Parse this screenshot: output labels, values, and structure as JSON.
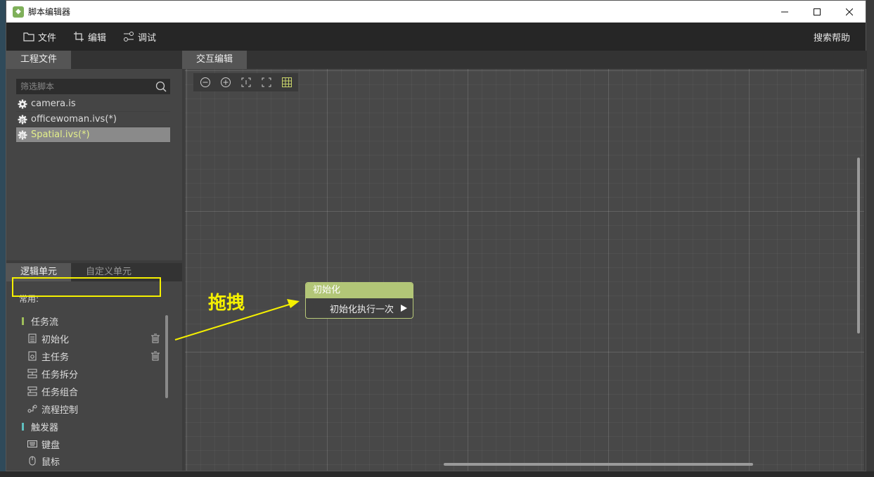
{
  "window": {
    "title": "脚本编辑器",
    "controls": [
      "minimize",
      "maximize",
      "close"
    ]
  },
  "menubar": {
    "items": [
      {
        "label": "文件",
        "icon": "folder-icon"
      },
      {
        "label": "编辑",
        "icon": "crop-icon"
      },
      {
        "label": "调试",
        "icon": "debug-icon"
      }
    ],
    "help_label": "搜索帮助"
  },
  "project_panel": {
    "tab_label": "工程文件",
    "search": {
      "placeholder": "筛选脚本"
    },
    "files": [
      {
        "name": "camera.is",
        "icon": "gear-icon",
        "selected": false
      },
      {
        "name": "officewoman.ivs(*)",
        "icon": "gear-js-icon",
        "selected": false
      },
      {
        "name": "Spatial.ivs(*)",
        "icon": "gear-js-icon",
        "selected": true
      }
    ]
  },
  "logic_panel": {
    "tabs": [
      {
        "label": "逻辑单元",
        "active": true
      },
      {
        "label": "自定义单元",
        "active": false
      }
    ],
    "section_label": "常用:",
    "categories": [
      {
        "label": "任务流",
        "color": "#9fbf5a",
        "units": [
          {
            "label": "初始化",
            "icon": "clipboard-icon",
            "has_trash": true
          },
          {
            "label": "主任务",
            "icon": "task-icon",
            "has_trash": true
          },
          {
            "label": "任务拆分",
            "icon": "split-icon",
            "has_trash": false
          },
          {
            "label": "任务组合",
            "icon": "combine-icon",
            "has_trash": false
          },
          {
            "label": "流程控制",
            "icon": "flow-icon",
            "has_trash": false
          }
        ]
      },
      {
        "label": "触发器",
        "color": "#5fbfbf",
        "units": [
          {
            "label": "键盘",
            "icon": "keyboard-icon",
            "has_trash": false
          },
          {
            "label": "鼠标",
            "icon": "mouse-icon",
            "has_trash": false
          }
        ]
      }
    ]
  },
  "editor": {
    "tab_label": "交互编辑",
    "tools": [
      "zoom-out-icon",
      "zoom-in-icon",
      "fit-icon",
      "fullscreen-icon",
      "grid-icon"
    ],
    "node": {
      "title": "初始化",
      "output_label": "初始化执行一次",
      "header_color": "#b2c677"
    }
  },
  "annotation": {
    "label": "拖拽",
    "color": "#f5f000"
  }
}
